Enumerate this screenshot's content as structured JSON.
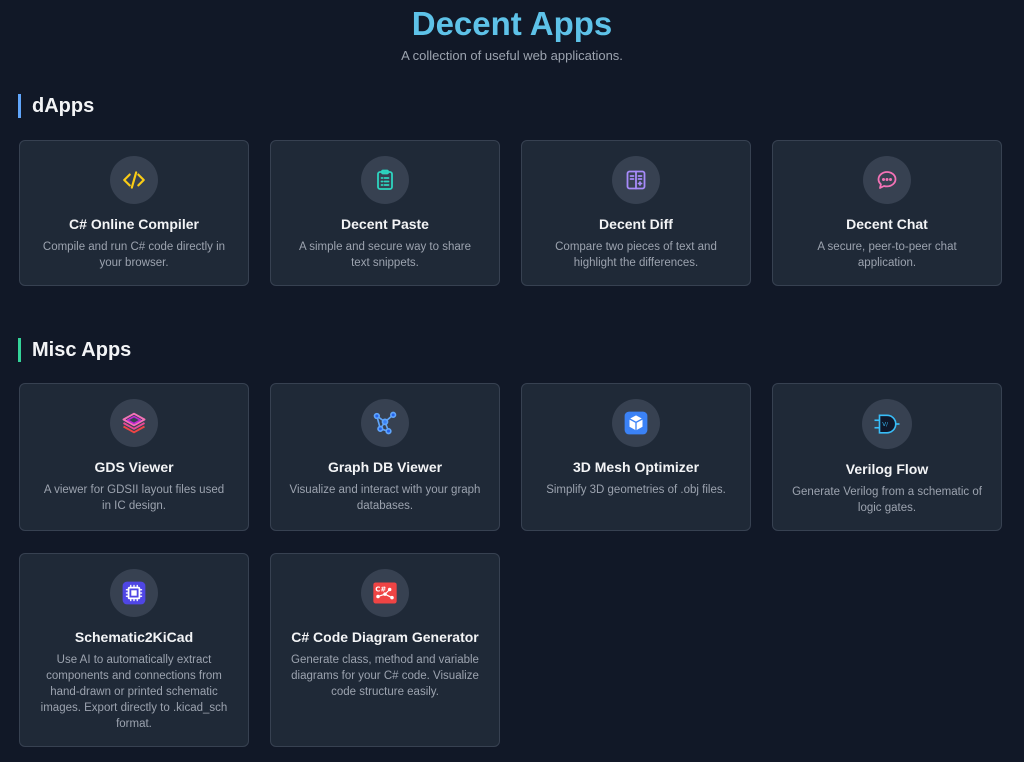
{
  "header": {
    "title": "Decent Apps",
    "subtitle": "A collection of useful web applications."
  },
  "sections": [
    {
      "title": "dApps",
      "accent": "#60a5fa",
      "apps": [
        {
          "title": "C# Online Compiler",
          "desc": "Compile and run C# code directly in your browser.",
          "icon": "code-icon",
          "color": "#facc15"
        },
        {
          "title": "Decent Paste",
          "desc": "A simple and secure way to share text snippets.",
          "icon": "clipboard-icon",
          "color": "#2dd4bf"
        },
        {
          "title": "Decent Diff",
          "desc": "Compare two pieces of text and highlight the differences.",
          "icon": "diff-icon",
          "color": "#a78bfa"
        },
        {
          "title": "Decent Chat",
          "desc": "A secure, peer-to-peer chat application.",
          "icon": "chat-icon",
          "color": "#f472b6"
        }
      ]
    },
    {
      "title": "Misc Apps",
      "accent": "#34d399",
      "apps": [
        {
          "title": "GDS Viewer",
          "desc": "A viewer for GDSII layout files used in IC design.",
          "icon": "layers-icon",
          "color": "#ec4899"
        },
        {
          "title": "Graph DB Viewer",
          "desc": "Visualize and interact with your graph databases.",
          "icon": "graph-icon",
          "color": "#60a5fa"
        },
        {
          "title": "3D Mesh Optimizer",
          "desc": "Simplify 3D geometries of .obj files.",
          "icon": "cube-icon",
          "color": "#3b82f6"
        },
        {
          "title": "Verilog Flow",
          "desc": "Generate Verilog from a schematic of logic gates.",
          "icon": "logic-gate-icon",
          "color": "#38bdf8"
        },
        {
          "title": "Schematic2KiCad",
          "desc": "Use AI to automatically extract components and connections from hand-drawn or printed schematic images. Export directly to .kicad_sch format.",
          "icon": "chip-icon",
          "color": "#6366f1"
        },
        {
          "title": "C# Code Diagram Generator",
          "desc": "Generate class, method and variable diagrams for your C# code. Visualize code structure easily.",
          "icon": "diagram-icon",
          "color": "#ef4444"
        }
      ]
    }
  ]
}
